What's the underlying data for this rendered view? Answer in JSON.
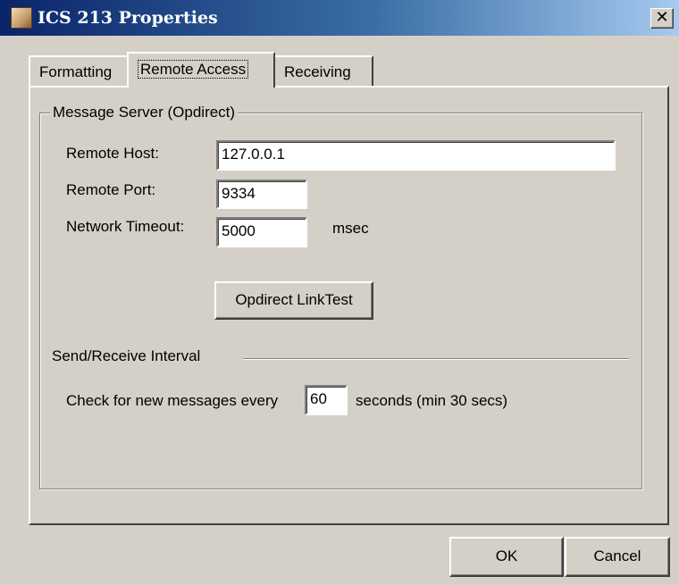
{
  "window": {
    "title": "ICS 213 Properties",
    "close_glyph": "✕",
    "icon": "app-icon"
  },
  "tabs": [
    {
      "label": "Formatting",
      "active": false
    },
    {
      "label": "Remote Access",
      "active": true
    },
    {
      "label": "Receiving",
      "active": false
    }
  ],
  "message_server": {
    "group_label": "Message Server (Opdirect)",
    "remote_host_label": "Remote Host:",
    "remote_host_value": "127.0.0.1",
    "remote_port_label": "Remote Port:",
    "remote_port_value": "9334",
    "timeout_label": "Network Timeout:",
    "timeout_value": "5000",
    "timeout_unit": "msec",
    "link_test_label": "Opdirect LinkTest"
  },
  "interval": {
    "section_label": "Send/Receive Interval",
    "check_prefix": "Check for new messages every",
    "check_value": "60",
    "check_suffix": "seconds (min 30 secs)"
  },
  "buttons": {
    "ok": "OK",
    "cancel": "Cancel"
  }
}
